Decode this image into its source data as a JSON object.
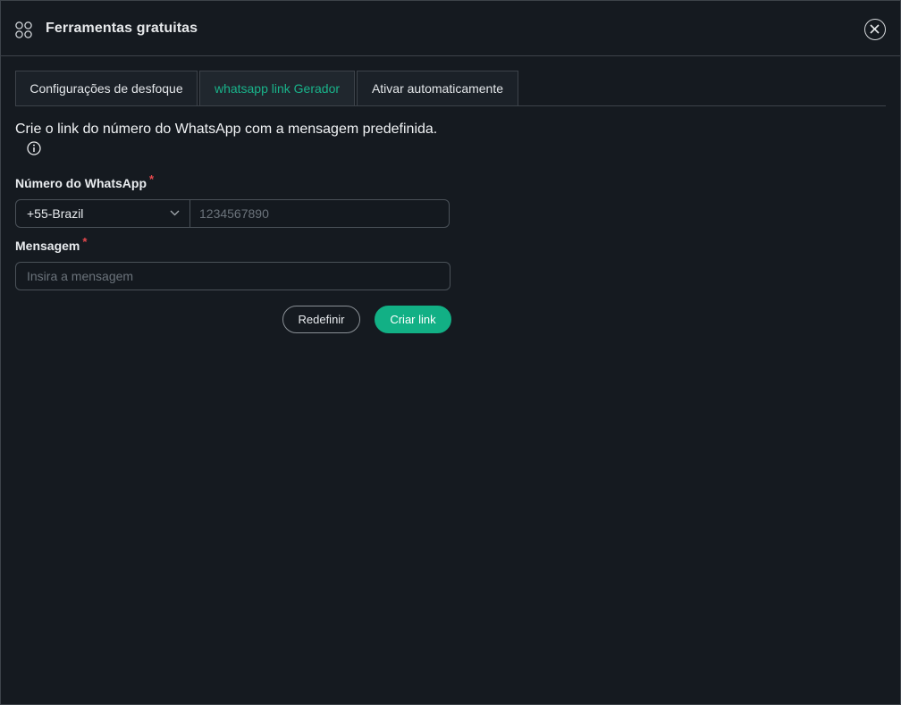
{
  "header": {
    "title": "Ferramentas gratuitas",
    "icon": "apps-grid-icon",
    "close_icon": "close-icon"
  },
  "tabs": [
    {
      "label": "Configurações de desfoque",
      "active": false
    },
    {
      "label": "whatsapp link Gerador",
      "active": true
    },
    {
      "label": "Ativar automaticamente",
      "active": false
    }
  ],
  "content": {
    "description": "Crie o link do número do WhatsApp com a mensagem predefinida.",
    "info_icon": "info-icon",
    "phone_label": "Número do WhatsApp",
    "required_mark": "*",
    "country_value": "+55-Brazil",
    "phone_value": "",
    "phone_placeholder": "1234567890",
    "message_label": "Mensagem",
    "message_value": "",
    "message_placeholder": "Insira a mensagem"
  },
  "actions": {
    "reset_label": "Redefinir",
    "create_label": "Criar link"
  },
  "colors": {
    "accent": "#12b085",
    "background": "#151a20",
    "border": "#3d434a",
    "required": "#e5484d"
  }
}
